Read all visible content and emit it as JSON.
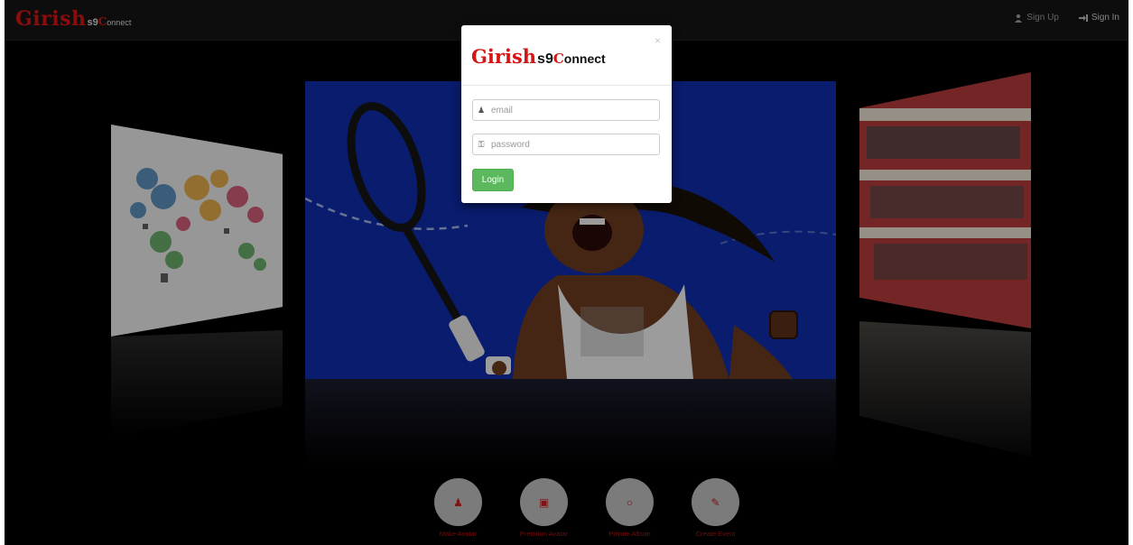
{
  "brand": {
    "main": "Girish",
    "s9": "s9",
    "c": "C",
    "rest": "onnect"
  },
  "nav": {
    "signup_label": "Sign Up",
    "signin_label": "Sign In"
  },
  "features": [
    {
      "label": "Make Avatar"
    },
    {
      "label": "Premium Avatar"
    },
    {
      "label": "Private Album"
    },
    {
      "label": "Create Event"
    }
  ],
  "modal": {
    "close": "×",
    "logo": {
      "main": "Girish",
      "s9": "s9",
      "c": "C",
      "rest": "onnect"
    },
    "email_placeholder": "email",
    "password_placeholder": "password",
    "login_label": "Login"
  },
  "colors": {
    "brand_red": "#d31515",
    "login_green": "#5cb85c",
    "center_bg": "#0e2ba8"
  },
  "icons": {
    "signup": "user-icon",
    "signin": "sign-in-icon",
    "email": "user-icon",
    "password": "key-icon"
  }
}
